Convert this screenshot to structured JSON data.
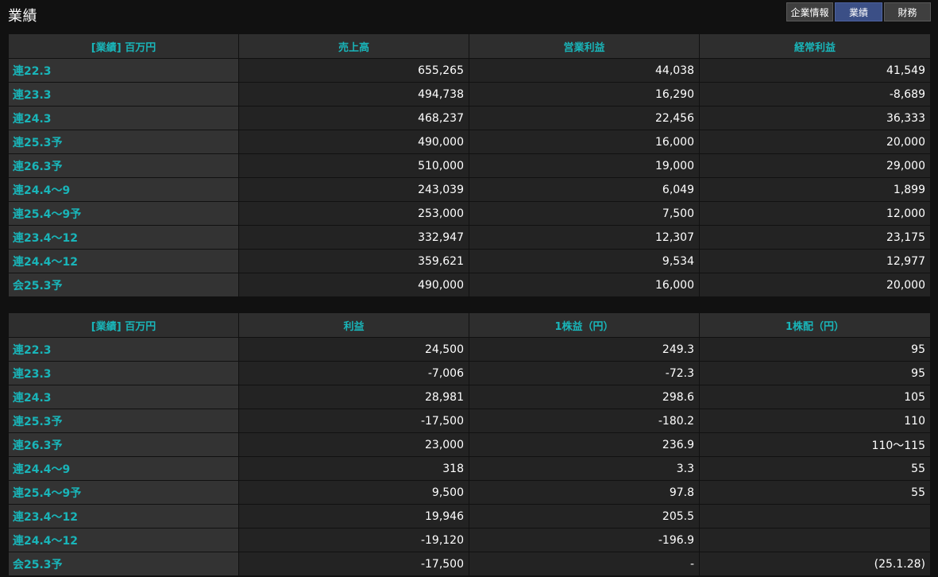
{
  "page": {
    "title": "業績"
  },
  "tabs": [
    {
      "label": "企業情報",
      "active": false
    },
    {
      "label": "業績",
      "active": true
    },
    {
      "label": "財務",
      "active": false
    }
  ],
  "upper_table": {
    "headers": [
      "[業績] 百万円",
      "売上高",
      "営業利益",
      "経常利益"
    ],
    "rows": [
      {
        "period": "連22.3",
        "v1": "655,265",
        "v2": "44,038",
        "v3": "41,549"
      },
      {
        "period": "連23.3",
        "v1": "494,738",
        "v2": "16,290",
        "v3": "-8,689"
      },
      {
        "period": "連24.3",
        "v1": "468,237",
        "v2": "22,456",
        "v3": "36,333"
      },
      {
        "period": "連25.3予",
        "v1": "490,000",
        "v2": "16,000",
        "v3": "20,000"
      },
      {
        "period": "連26.3予",
        "v1": "510,000",
        "v2": "19,000",
        "v3": "29,000"
      },
      {
        "period": "連24.4～9",
        "v1": "243,039",
        "v2": "6,049",
        "v3": "1,899"
      },
      {
        "period": "連25.4～9予",
        "v1": "253,000",
        "v2": "7,500",
        "v3": "12,000"
      },
      {
        "period": "連23.4～12",
        "v1": "332,947",
        "v2": "12,307",
        "v3": "23,175"
      },
      {
        "period": "連24.4～12",
        "v1": "359,621",
        "v2": "9,534",
        "v3": "12,977"
      },
      {
        "period": "会25.3予",
        "v1": "490,000",
        "v2": "16,000",
        "v3": "20,000"
      }
    ]
  },
  "lower_table": {
    "headers": [
      "[業績] 百万円",
      "利益",
      "1株益（円）",
      "1株配（円）"
    ],
    "rows": [
      {
        "period": "連22.3",
        "v1": "24,500",
        "v2": "249.3",
        "v3": "95"
      },
      {
        "period": "連23.3",
        "v1": "-7,006",
        "v2": "-72.3",
        "v3": "95"
      },
      {
        "period": "連24.3",
        "v1": "28,981",
        "v2": "298.6",
        "v3": "105"
      },
      {
        "period": "連25.3予",
        "v1": "-17,500",
        "v2": "-180.2",
        "v3": "110"
      },
      {
        "period": "連26.3予",
        "v1": "23,000",
        "v2": "236.9",
        "v3": "110～115"
      },
      {
        "period": "連24.4～9",
        "v1": "318",
        "v2": "3.3",
        "v3": "55"
      },
      {
        "period": "連25.4～9予",
        "v1": "9,500",
        "v2": "97.8",
        "v3": "55"
      },
      {
        "period": "連23.4～12",
        "v1": "19,946",
        "v2": "205.5",
        "v3": ""
      },
      {
        "period": "連24.4～12",
        "v1": "-19,120",
        "v2": "-196.9",
        "v3": ""
      },
      {
        "period": "会25.3予",
        "v1": "-17,500",
        "v2": "-",
        "v3": "(25.1.28)"
      }
    ]
  },
  "colors": {
    "background": "#111111",
    "label_text": "#19b5b9",
    "active_tab": "#3b4f86"
  }
}
